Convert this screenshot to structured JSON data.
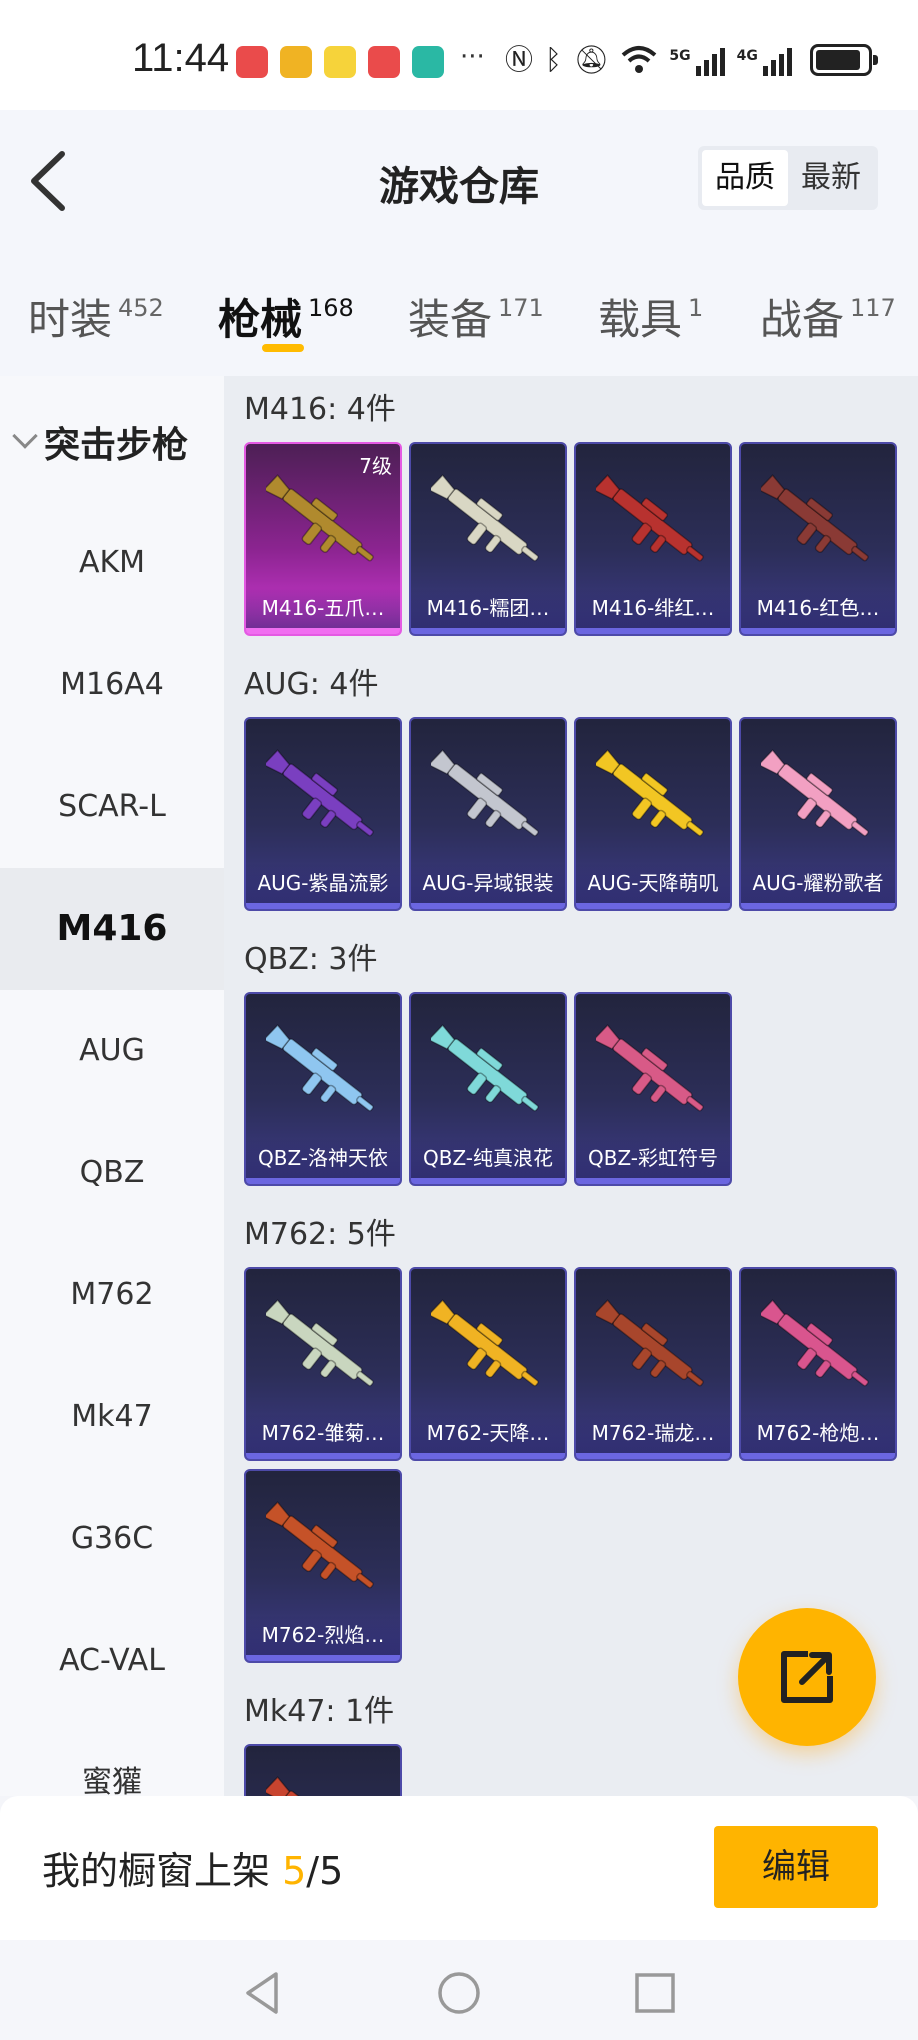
{
  "status_bar": {
    "time": "11:44",
    "more": "···",
    "net_5g": "5G",
    "net_4g": "4G",
    "app_icons": [
      "huawei-app",
      "target-app",
      "yellow-app",
      "huawei-app",
      "shield-app"
    ],
    "colors": {
      "huawei": "#ea4b4b",
      "target": "#f0b323",
      "yellow": "#f6d33a",
      "shield": "#2ab8a4"
    }
  },
  "header": {
    "title": "游戏仓库",
    "sort": {
      "quality": "品质",
      "newest": "最新",
      "active": "quality"
    }
  },
  "tabs": [
    {
      "label": "时装",
      "count": "452"
    },
    {
      "label": "枪械",
      "count": "168",
      "active": true
    },
    {
      "label": "装备",
      "count": "171"
    },
    {
      "label": "载具",
      "count": "1"
    },
    {
      "label": "战备",
      "count": "117"
    }
  ],
  "sidebar": {
    "group": "突击步枪",
    "items": [
      "AKM",
      "M16A4",
      "SCAR-L",
      "M416",
      "AUG",
      "QBZ",
      "M762",
      "Mk47",
      "G36C",
      "AC-VAL",
      "蜜獾"
    ],
    "active": "M416"
  },
  "sections": [
    {
      "title": "M416: 4件",
      "items": [
        {
          "name": "M416-五爪…",
          "level": "7级",
          "tier": "legend",
          "gun_color": "#b08a2e"
        },
        {
          "name": "M416-糯团…",
          "tier": "epic",
          "gun_color": "#d9d7c4"
        },
        {
          "name": "M416-绯红…",
          "tier": "epic",
          "gun_color": "#b8322f"
        },
        {
          "name": "M416-红色…",
          "tier": "epic",
          "gun_color": "#8a3a35"
        }
      ]
    },
    {
      "title": "AUG: 4件",
      "items": [
        {
          "name": "AUG-紫晶流影",
          "tier": "epic",
          "gun_color": "#7a3fc0"
        },
        {
          "name": "AUG-异域银装",
          "tier": "epic",
          "gun_color": "#c3c6cf"
        },
        {
          "name": "AUG-天降萌叽",
          "tier": "epic",
          "gun_color": "#f2c623"
        },
        {
          "name": "AUG-耀粉歌者",
          "tier": "epic",
          "gun_color": "#f2a0c2"
        }
      ]
    },
    {
      "title": "QBZ: 3件",
      "items": [
        {
          "name": "QBZ-洛神天依",
          "tier": "epic",
          "gun_color": "#8fc6f0"
        },
        {
          "name": "QBZ-纯真浪花",
          "tier": "epic",
          "gun_color": "#7fd9d9"
        },
        {
          "name": "QBZ-彩虹符号",
          "tier": "epic",
          "gun_color": "#d85a87"
        }
      ]
    },
    {
      "title": "M762: 5件",
      "items": [
        {
          "name": "M762-雏菊…",
          "tier": "epic",
          "gun_color": "#c9d6bf"
        },
        {
          "name": "M762-天降…",
          "tier": "epic",
          "gun_color": "#f0b323"
        },
        {
          "name": "M762-瑞龙…",
          "tier": "epic",
          "gun_color": "#a8462c"
        },
        {
          "name": "M762-枪炮…",
          "tier": "epic",
          "gun_color": "#d9558e"
        },
        {
          "name": "M762-烈焰…",
          "tier": "epic",
          "gun_color": "#c55228"
        }
      ]
    },
    {
      "title": "Mk47: 1件",
      "items": [
        {
          "name": "",
          "tier": "epic",
          "gun_color": "#c8442f"
        }
      ]
    }
  ],
  "bottom": {
    "shelf_label": "我的橱窗上架",
    "shelf_current": "5",
    "shelf_sep": "/",
    "shelf_total": "5",
    "edit": "编辑"
  },
  "accent": "#ffb400"
}
